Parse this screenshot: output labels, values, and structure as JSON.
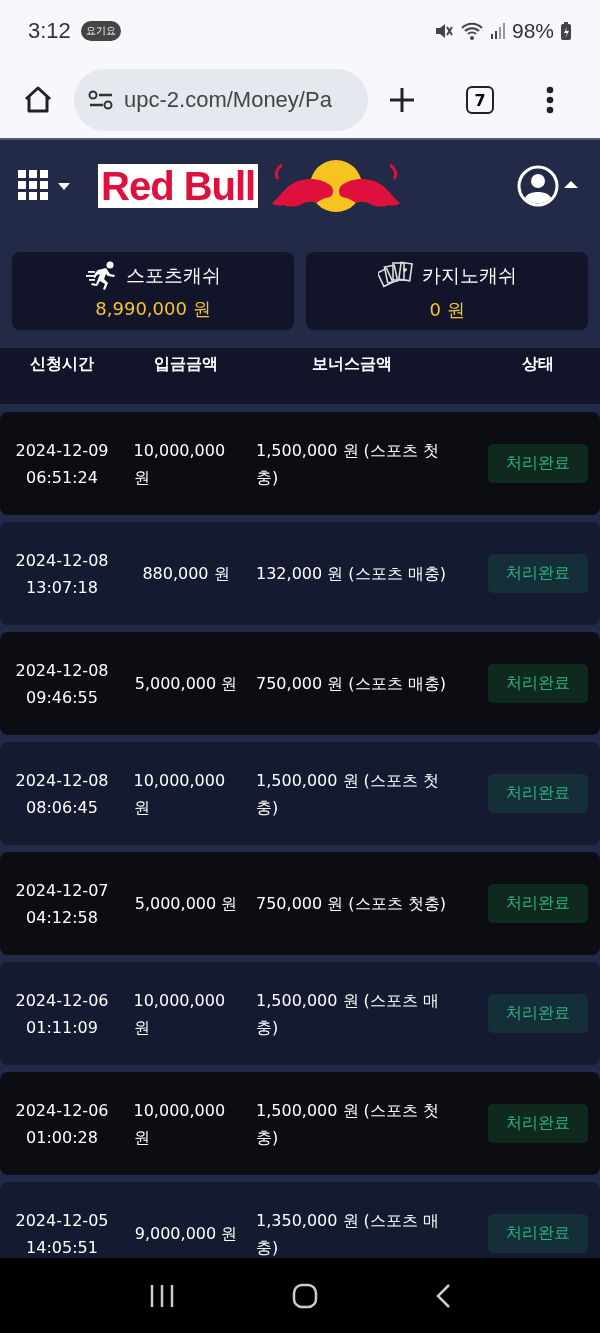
{
  "status_bar": {
    "time": "3:12",
    "notification_badge": "요기요",
    "battery": "98%"
  },
  "browser": {
    "url": "upc-2.com/Money/Pa",
    "tab_count": "7"
  },
  "header": {
    "logo": "Red Bull"
  },
  "wallets": [
    {
      "kind": "sports",
      "label": "스포츠캐쉬",
      "amount": "8,990,000 원"
    },
    {
      "kind": "casino",
      "label": "카지노캐쉬",
      "amount": "0 원"
    }
  ],
  "table": {
    "columns": [
      "신청시간",
      "입금금액",
      "보너스금액",
      "상태"
    ],
    "rows": [
      {
        "date": "2024-12-09",
        "time": "06:51:24",
        "deposit": "10,000,000 원",
        "bonus": "1,500,000 원 (스포츠 첫충)",
        "status": "처리완료"
      },
      {
        "date": "2024-12-08",
        "time": "13:07:18",
        "deposit": "880,000 원",
        "bonus": "132,000 원 (스포츠 매충)",
        "status": "처리완료"
      },
      {
        "date": "2024-12-08",
        "time": "09:46:55",
        "deposit": "5,000,000 원",
        "bonus": "750,000 원 (스포츠 매충)",
        "status": "처리완료"
      },
      {
        "date": "2024-12-08",
        "time": "08:06:45",
        "deposit": "10,000,000 원",
        "bonus": "1,500,000 원 (스포츠 첫충)",
        "status": "처리완료"
      },
      {
        "date": "2024-12-07",
        "time": "04:12:58",
        "deposit": "5,000,000 원",
        "bonus": "750,000 원 (스포츠 첫충)",
        "status": "처리완료"
      },
      {
        "date": "2024-12-06",
        "time": "01:11:09",
        "deposit": "10,000,000 원",
        "bonus": "1,500,000 원 (스포츠 매충)",
        "status": "처리완료"
      },
      {
        "date": "2024-12-06",
        "time": "01:00:28",
        "deposit": "10,000,000 원",
        "bonus": "1,500,000 원 (스포츠 첫충)",
        "status": "처리완료"
      },
      {
        "date": "2024-12-05",
        "time": "14:05:51",
        "deposit": "9,000,000 원",
        "bonus": "1,350,000 원 (스포츠 매충)",
        "status": "처리완료"
      }
    ]
  }
}
